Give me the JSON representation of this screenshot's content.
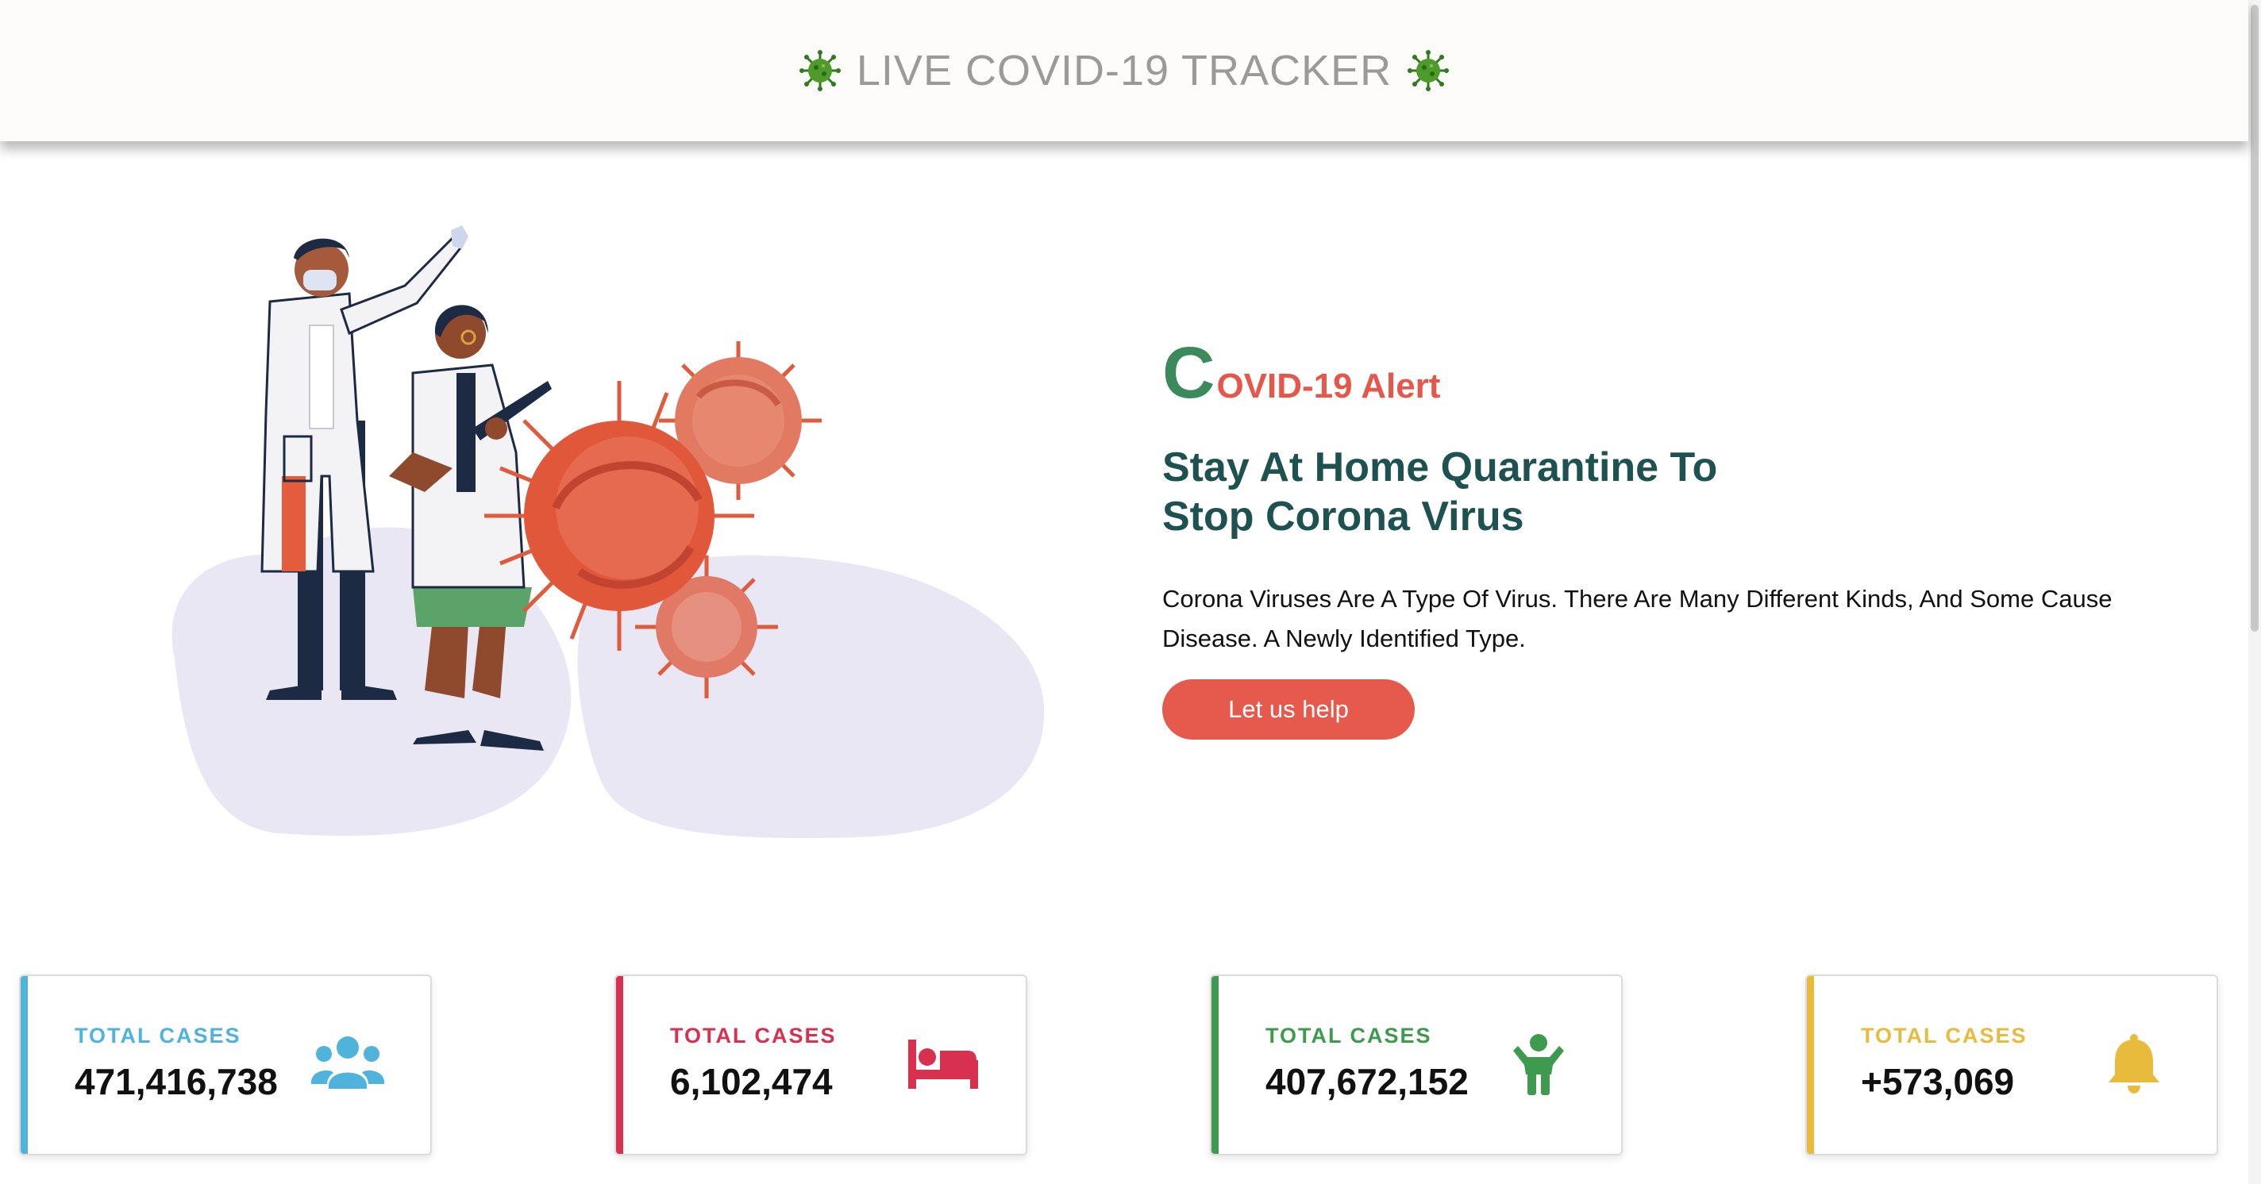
{
  "header": {
    "title": "LIVE COVID-19 TRACKER",
    "icon_left": "virus-icon",
    "icon_right": "virus-icon"
  },
  "hero": {
    "alert_first_letter": "C",
    "alert_rest": "OVID-19 Alert",
    "headline_line1": "Stay At Home Quarantine To",
    "headline_line2": "Stop Corona Virus",
    "description": "Corona Viruses Are A Type Of Virus. There Are Many Different Kinds, And Some Cause Disease. A Newly Identified Type.",
    "button_label": "Let us help",
    "illustration": "doctors-and-virus-illustration"
  },
  "cards": [
    {
      "label": "TOTAL CASES",
      "value": "471,416,738",
      "color": "#4fb3dc",
      "icon": "users-icon"
    },
    {
      "label": "TOTAL CASES",
      "value": "6,102,474",
      "color": "#d8304f",
      "icon": "bed-icon"
    },
    {
      "label": "TOTAL CASES",
      "value": "407,672,152",
      "color": "#3d9a4e",
      "icon": "child-icon"
    },
    {
      "label": "TOTAL CASES",
      "value": "+573,069",
      "color": "#e9bb3c",
      "icon": "bell-icon"
    }
  ],
  "colors": {
    "brand_green": "#3a8a5c",
    "alert_red": "#e5574a",
    "headline_teal": "#1e5250",
    "button_red": "#e55a4c"
  }
}
